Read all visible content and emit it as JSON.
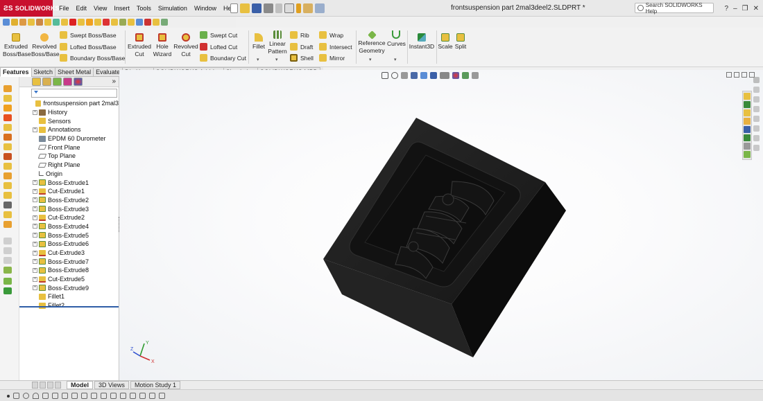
{
  "app": {
    "brand": "SOLIDWORKS",
    "doc_title": "frontsuspension part 2mal3deel2.SLDPRT *"
  },
  "menu": [
    "File",
    "Edit",
    "View",
    "Insert",
    "Tools",
    "Simulation",
    "Window",
    "Help"
  ],
  "search": {
    "placeholder": "Search SOLIDWORKS Help"
  },
  "ribbon": {
    "extruded_boss": "Extruded Boss/Base",
    "revolved_boss": "Revolved Boss/Base",
    "swept_boss": "Swept Boss/Base",
    "lofted_boss": "Lofted Boss/Base",
    "boundary_boss": "Boundary Boss/Base",
    "extruded_cut": "Extruded Cut",
    "hole_wizard": "Hole Wizard",
    "revolved_cut": "Revolved Cut",
    "swept_cut": "Swept Cut",
    "lofted_cut": "Lofted Cut",
    "boundary_cut": "Boundary Cut",
    "fillet": "Fillet",
    "linear_pattern": "Linear Pattern",
    "rib": "Rib",
    "draft": "Draft",
    "shell": "Shell",
    "wrap": "Wrap",
    "intersect": "Intersect",
    "mirror": "Mirror",
    "reference_geometry": "Reference Geometry",
    "curves": "Curves",
    "instant3d": "Instant3D",
    "scale": "Scale",
    "split": "Split"
  },
  "command_tabs": [
    "Features",
    "Sketch",
    "Sheet Metal",
    "Evaluate",
    "DimXpert",
    "SOLIDWORKS Add-Ins",
    "Simulation",
    "SOLIDWORKS MBD"
  ],
  "tree": [
    {
      "label": "frontsuspension part 2mal3",
      "icon": "part-icon",
      "expand": false,
      "root": true
    },
    {
      "label": "History",
      "icon": "history-icon",
      "expand": true
    },
    {
      "label": "Sensors",
      "icon": "sensors-icon",
      "expand": false
    },
    {
      "label": "Annotations",
      "icon": "annotations-icon",
      "expand": true
    },
    {
      "label": "EPDM 60 Durometer",
      "icon": "material-icon",
      "expand": false
    },
    {
      "label": "Front Plane",
      "icon": "plane-icon",
      "expand": false
    },
    {
      "label": "Top Plane",
      "icon": "plane-icon",
      "expand": false
    },
    {
      "label": "Right Plane",
      "icon": "plane-icon",
      "expand": false
    },
    {
      "label": "Origin",
      "icon": "origin-icon",
      "expand": false
    },
    {
      "label": "Boss-Extrude1",
      "icon": "boss-extrude-icon",
      "expand": true
    },
    {
      "label": "Cut-Extrude1",
      "icon": "cut-extrude-icon",
      "expand": true
    },
    {
      "label": "Boss-Extrude2",
      "icon": "boss-extrude-icon",
      "expand": true
    },
    {
      "label": "Boss-Extrude3",
      "icon": "boss-extrude-icon",
      "expand": true
    },
    {
      "label": "Cut-Extrude2",
      "icon": "cut-extrude-icon",
      "expand": true
    },
    {
      "label": "Boss-Extrude4",
      "icon": "boss-extrude-icon",
      "expand": true
    },
    {
      "label": "Boss-Extrude5",
      "icon": "boss-extrude-icon",
      "expand": true
    },
    {
      "label": "Boss-Extrude6",
      "icon": "boss-extrude-icon",
      "expand": true
    },
    {
      "label": "Cut-Extrude3",
      "icon": "cut-extrude-icon",
      "expand": true
    },
    {
      "label": "Boss-Extrude7",
      "icon": "boss-extrude-icon",
      "expand": true
    },
    {
      "label": "Boss-Extrude8",
      "icon": "boss-extrude-icon",
      "expand": true
    },
    {
      "label": "Cut-Extrude5",
      "icon": "cut-extrude-icon",
      "expand": true
    },
    {
      "label": "Boss-Extrude9",
      "icon": "boss-extrude-icon",
      "expand": true
    },
    {
      "label": "Fillet1",
      "icon": "fillet-icon",
      "expand": false
    },
    {
      "label": "Fillet2",
      "icon": "fillet-icon",
      "expand": false
    }
  ],
  "bottom_tabs": [
    "Model",
    "3D Views",
    "Motion Study 1"
  ],
  "triad": {
    "x": "X",
    "y": "Y",
    "z": "Z"
  },
  "colors": {
    "brand": "#c8102e",
    "part": "#1b1b1b",
    "accent": "#2e5da6"
  }
}
